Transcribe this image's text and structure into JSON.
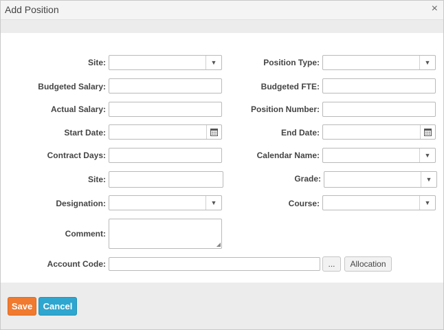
{
  "dialog": {
    "title": "Add Position",
    "close_glyph": "×"
  },
  "form": {
    "site_label": "Site:",
    "position_type_label": "Position Type:",
    "budgeted_salary_label": "Budgeted Salary:",
    "budgeted_fte_label": "Budgeted FTE:",
    "actual_salary_label": "Actual Salary:",
    "position_number_label": "Position Number:",
    "start_date_label": "Start Date:",
    "end_date_label": "End Date:",
    "contract_days_label": "Contract Days:",
    "calendar_name_label": "Calendar Name:",
    "site2_label": "Site:",
    "grade_label": "Grade:",
    "designation_label": "Designation:",
    "course_label": "Course:",
    "comment_label": "Comment:",
    "account_code_label": "Account Code:",
    "ellipsis_label": "...",
    "allocation_label": "Allocation",
    "dropdown_glyph": "▼"
  },
  "footer": {
    "save_label": "Save",
    "cancel_label": "Cancel",
    "save_color": "#f07a2f",
    "cancel_color": "#2ea6cf"
  },
  "icons": {
    "calendar": "calendar-icon",
    "dropdown": "chevron-down-icon",
    "close": "close-icon"
  }
}
